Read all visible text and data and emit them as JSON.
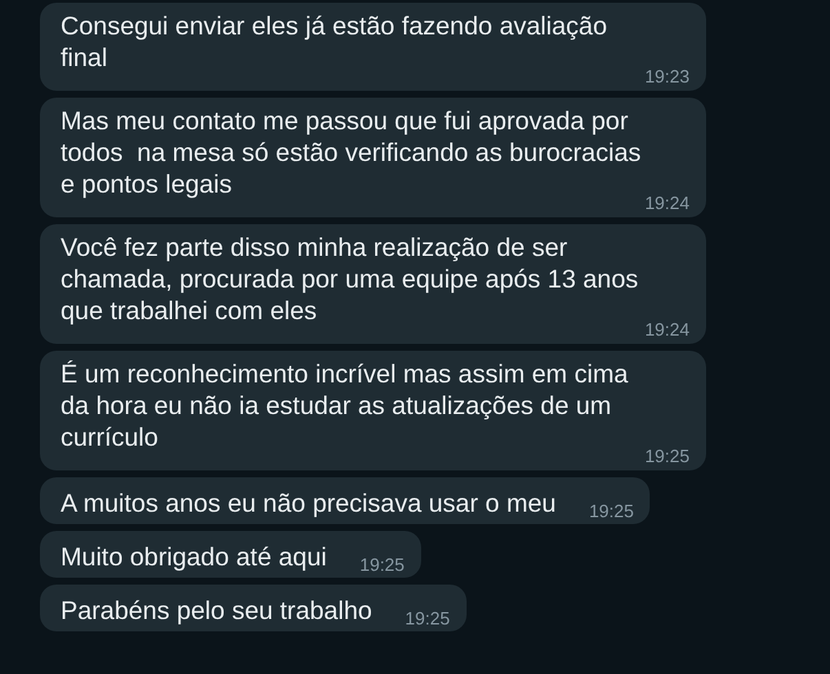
{
  "messages": [
    {
      "text": "Consegui enviar eles já estão fazendo avaliação\nfinal",
      "time": "19:23"
    },
    {
      "text": "Mas meu contato me passou que fui aprovada por\ntodos  na mesa só estão verificando as burocracias\ne pontos legais",
      "time": "19:24"
    },
    {
      "text": "Você fez parte disso minha realização de ser\nchamada, procurada por uma equipe após 13 anos\nque trabalhei com eles",
      "time": "19:24"
    },
    {
      "text": "É um reconhecimento incrível mas assim em cima\nda hora eu não ia estudar as atualizações de um\ncurrículo",
      "time": "19:25"
    },
    {
      "text": "A muitos anos eu não precisava usar o meu",
      "time": "19:25"
    },
    {
      "text": "Muito obrigado até aqui",
      "time": "19:25"
    },
    {
      "text": "Parabéns pelo seu trabalho",
      "time": "19:25"
    }
  ]
}
